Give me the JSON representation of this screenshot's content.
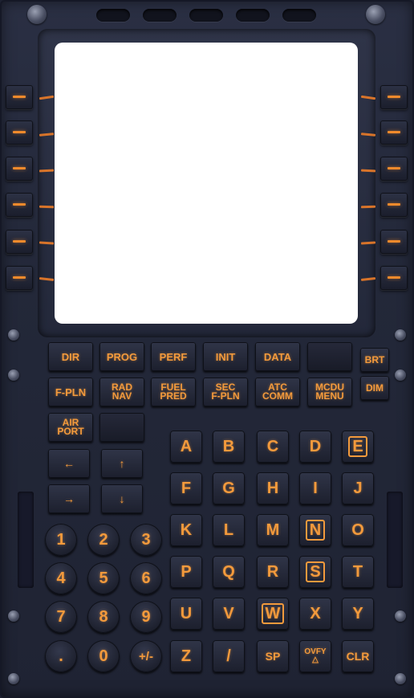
{
  "screen": {
    "content": ""
  },
  "function_keys": {
    "row1": [
      {
        "id": "dir",
        "label": "DIR"
      },
      {
        "id": "prog",
        "label": "PROG"
      },
      {
        "id": "perf",
        "label": "PERF"
      },
      {
        "id": "init",
        "label": "INIT"
      },
      {
        "id": "data",
        "label": "DATA"
      },
      {
        "id": "blank",
        "label": ""
      }
    ],
    "row2": [
      {
        "id": "f-pln",
        "label": "F-PLN"
      },
      {
        "id": "rad-nav",
        "label": "RAD\nNAV"
      },
      {
        "id": "fuel-pred",
        "label": "FUEL\nPRED"
      },
      {
        "id": "sec-f-pln",
        "label": "SEC\nF-PLN"
      },
      {
        "id": "atc-comm",
        "label": "ATC\nCOMM"
      },
      {
        "id": "mcdu-menu",
        "label": "MCDU\nMENU"
      }
    ],
    "brt": "BRT",
    "dim": "DIM",
    "airport": "AIR\nPORT"
  },
  "arrows": {
    "left": "←",
    "right": "→",
    "up": "↑",
    "down": "↓"
  },
  "alpha_keys": [
    [
      "A",
      "B",
      "C",
      "D",
      "E"
    ],
    [
      "F",
      "G",
      "H",
      "I",
      "J"
    ],
    [
      "K",
      "L",
      "M",
      "N",
      "O"
    ],
    [
      "P",
      "Q",
      "R",
      "S",
      "T"
    ],
    [
      "U",
      "V",
      "W",
      "X",
      "Y"
    ],
    [
      "Z",
      "/",
      "SP",
      "OVFY\n△",
      "CLR"
    ]
  ],
  "numeric_keys": [
    [
      "1",
      "2",
      "3"
    ],
    [
      "4",
      "5",
      "6"
    ],
    [
      "7",
      "8",
      "9"
    ],
    [
      ".",
      "0",
      "+/-"
    ]
  ],
  "colors": {
    "panel": "#232839",
    "key_text": "#f39a3c",
    "screen": "#ffffff"
  }
}
